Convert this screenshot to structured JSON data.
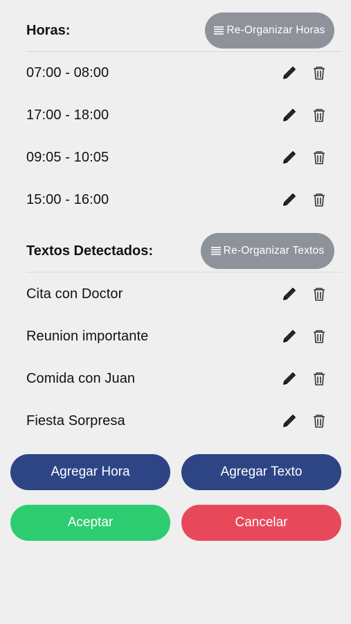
{
  "horas": {
    "title": "Horas:",
    "reorganize_label": "Re-Organizar Horas",
    "items": [
      {
        "label": "07:00 - 08:00"
      },
      {
        "label": "17:00 - 18:00"
      },
      {
        "label": "09:05 - 10:05"
      },
      {
        "label": "15:00 - 16:00"
      }
    ]
  },
  "textos": {
    "title": "Textos Detectados:",
    "reorganize_label": "Re-Organizar Textos",
    "items": [
      {
        "label": "Cita con Doctor"
      },
      {
        "label": "Reunion importante"
      },
      {
        "label": "Comida con Juan"
      },
      {
        "label": "Fiesta Sorpresa"
      }
    ]
  },
  "actions": {
    "add_hour": "Agregar Hora",
    "add_text": "Agregar Texto",
    "accept": "Aceptar",
    "cancel": "Cancelar"
  },
  "icons": {
    "reorder": "reorder-lines-icon",
    "edit": "pencil-icon",
    "delete": "trash-icon"
  },
  "colors": {
    "background": "#efefef",
    "reorganize_button": "#8e939b",
    "primary_button": "#2d4585",
    "accept_button": "#2ecc71",
    "cancel_button": "#e8495a"
  }
}
